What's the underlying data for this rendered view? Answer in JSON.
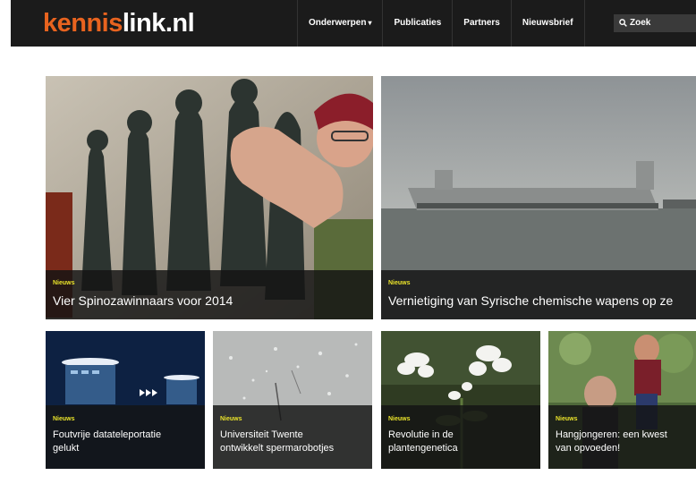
{
  "header": {
    "logo_part1": "kennis",
    "logo_part2": "link.nl",
    "nav": [
      {
        "label": "Onderwerpen",
        "caret": "▾"
      },
      {
        "label": "Publicaties"
      },
      {
        "label": "Partners"
      },
      {
        "label": "Nieuwsbrief"
      }
    ],
    "search_label": "Zoek"
  },
  "featured": [
    {
      "tag": "Nieuws",
      "title": "Vier Spinozawinnaars voor 2014"
    },
    {
      "tag": "Nieuws",
      "title": "Vernietiging van Syrische chemische wapens op ze"
    }
  ],
  "articles": [
    {
      "tag": "Nieuws",
      "title_line1": "Foutvrije datateleportatie",
      "title_line2": "gelukt"
    },
    {
      "tag": "Nieuws",
      "title_line1": "Universiteit Twente",
      "title_line2": "ontwikkelt spermarobotjes"
    },
    {
      "tag": "Nieuws",
      "title_line1": "Revolutie in de",
      "title_line2": "plantengenetica"
    },
    {
      "tag": "Nieuws",
      "title_line1": "Hangjongeren: een kwest",
      "title_line2": "van opvoeden!"
    }
  ],
  "colors": {
    "brand_orange": "#e8631f",
    "header_bg": "#1b1b1b",
    "tag_yellow": "#e9e22a"
  }
}
